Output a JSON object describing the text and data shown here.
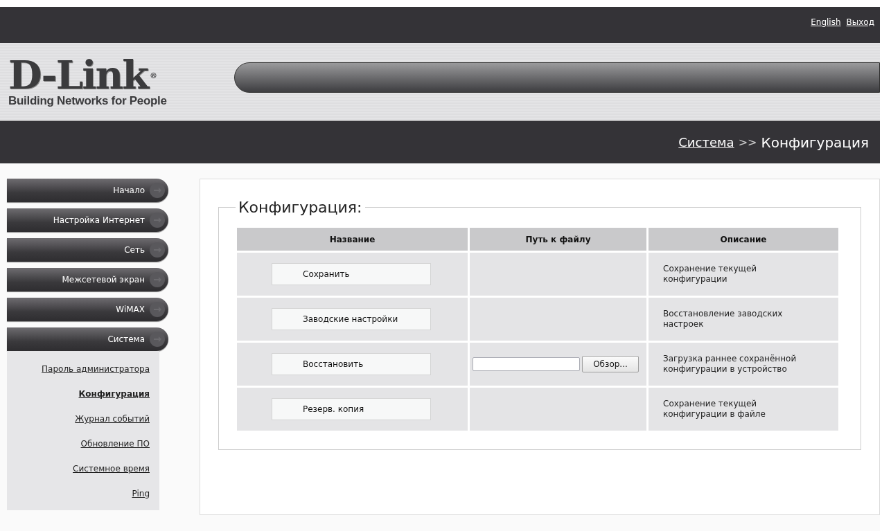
{
  "top_links": [
    {
      "label": "English"
    },
    {
      "label": "Выход"
    }
  ],
  "logo": {
    "name": "D-Link",
    "registered": "®",
    "tagline": "Building Networks for People"
  },
  "breadcrumb": {
    "parent": "Система",
    "separator": ">>",
    "current": "Конфигурация"
  },
  "menu": [
    {
      "label": "Начало",
      "expanded": false
    },
    {
      "label": "Настройка Интернет",
      "expanded": false
    },
    {
      "label": "Сеть",
      "expanded": false
    },
    {
      "label": "Межсетевой экран",
      "expanded": false
    },
    {
      "label": "WiMAX",
      "expanded": false
    },
    {
      "label": "Система",
      "expanded": true,
      "children": [
        {
          "label": "Пароль администратора",
          "selected": false
        },
        {
          "label": "Конфигурация",
          "selected": true
        },
        {
          "label": "Журнал событий",
          "selected": false
        },
        {
          "label": "Обновление ПО",
          "selected": false
        },
        {
          "label": "Системное время",
          "selected": false
        },
        {
          "label": "Ping",
          "selected": false
        }
      ]
    }
  ],
  "panel": {
    "title": "Конфигурация:",
    "table": {
      "columns": [
        "Название",
        "Путь к файлу",
        "Описание"
      ],
      "rows": [
        {
          "action": "Сохранить",
          "file_picker": false,
          "description": "Сохранение текущей конфигурации"
        },
        {
          "action": "Заводские настройки",
          "file_picker": false,
          "description": "Восстановление заводских настроек"
        },
        {
          "action": "Восстановить",
          "file_picker": true,
          "browse": "Обзор...",
          "description": "Загрузка раннее сохранённой конфигурации в устройство"
        },
        {
          "action": "Резерв. копия",
          "file_picker": false,
          "description": "Сохранение текущей конфигурации в файле"
        }
      ]
    }
  }
}
